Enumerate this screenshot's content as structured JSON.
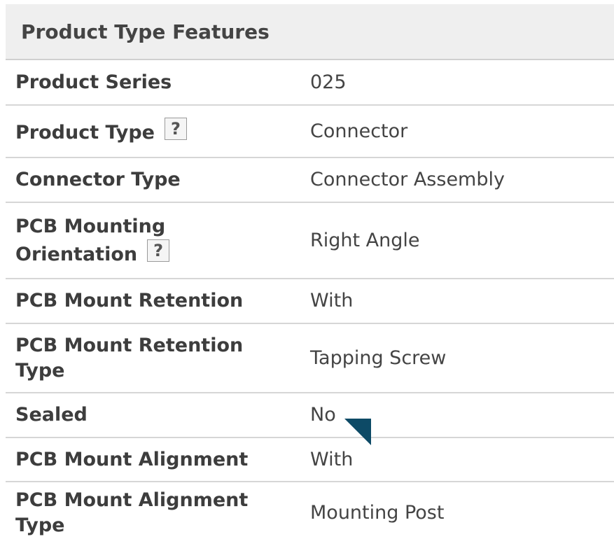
{
  "header": {
    "title": "Product Type Features"
  },
  "help_icon_glyph": "?",
  "rows": [
    {
      "label": "Product Series",
      "value": "025"
    },
    {
      "label": "Product Type",
      "value": "Connector"
    },
    {
      "label": "Connector Type",
      "value": "Connector Assembly"
    },
    {
      "label": "PCB Mounting Orientation",
      "value": "Right Angle"
    },
    {
      "label": "PCB Mount Retention",
      "value": "With"
    },
    {
      "label": "PCB Mount Retention Type",
      "value": "Tapping Screw"
    },
    {
      "label": "Sealed",
      "value": "No"
    },
    {
      "label": "PCB Mount Alignment",
      "value": "With"
    },
    {
      "label": "PCB Mount Alignment Type",
      "value": "Mounting Post"
    }
  ],
  "colors": {
    "header_bg": "#efefef",
    "row_border": "#d6d6d6",
    "text": "#3d3d3d",
    "cursor": "#0d4a66"
  },
  "icons": {
    "help": "help-icon",
    "cursor": "cursor-arrow-icon"
  }
}
